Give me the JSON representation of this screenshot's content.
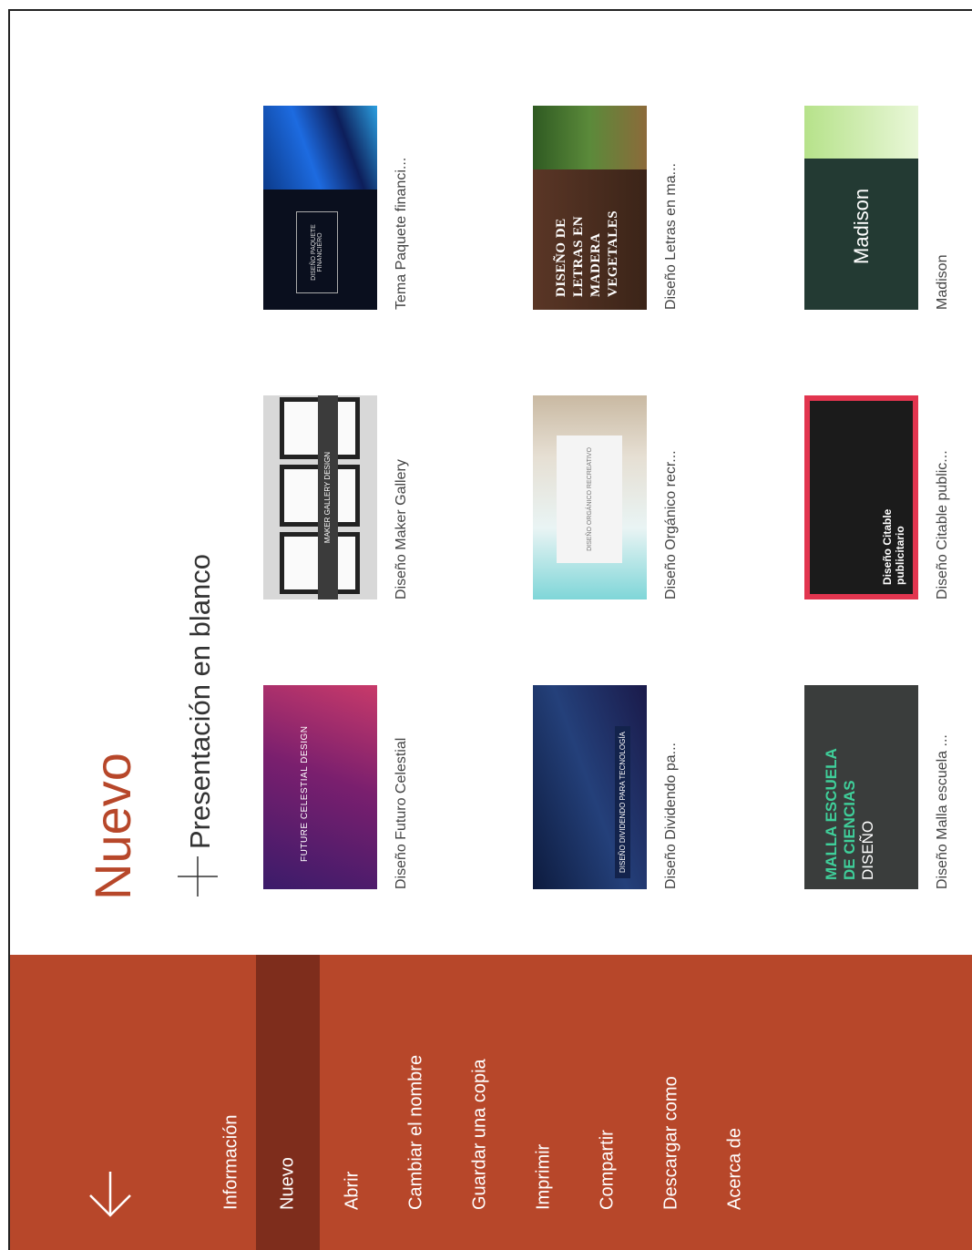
{
  "sidebar": {
    "back_icon": "arrow-left-icon",
    "items": [
      {
        "label": "Información"
      },
      {
        "label": "Nuevo",
        "active": true
      },
      {
        "label": "Abrir"
      },
      {
        "label": "Cambiar el nombre"
      },
      {
        "label": "Guardar una copia"
      },
      {
        "label": "Imprimir"
      },
      {
        "label": "Compartir"
      },
      {
        "label": "Descargar como"
      },
      {
        "label": "Acerca de"
      }
    ],
    "accent": "#b7472a",
    "active_bg": "#7e2d1c"
  },
  "main": {
    "title": "Nuevo",
    "blank_label": "Presentación en blanco",
    "templates": [
      {
        "caption": "Diseño Futuro Celestial",
        "thumb_text": "FUTURE CELESTIAL DESIGN"
      },
      {
        "caption": "Diseño Maker Gallery",
        "thumb_text": "MAKER GALLERY DESIGN"
      },
      {
        "caption": "Tema Paquete financi...",
        "thumb_text": "DISEÑO PAQUETE FINANCIERO"
      },
      {
        "caption": "Diseño Dividendo pa...",
        "thumb_text": "DISEÑO DIVIDENDO PARA TECNOLOGÍA"
      },
      {
        "caption": "Diseño Orgánico recr...",
        "thumb_text": "DISEÑO ORGÁNICO RECREATIVO"
      },
      {
        "caption": "Diseño Letras en ma...",
        "thumb_text": "DISEÑO DE LETRAS EN MADERA VEGETALES"
      },
      {
        "caption": "Diseño Malla escuela ...",
        "thumb_text_1": "MALLA ESCUELA DE CIENCIAS",
        "thumb_text_2": "DISEÑO"
      },
      {
        "caption": "Diseño Citable public...",
        "thumb_text": "Diseño Citable publicitario"
      },
      {
        "caption": "Madison",
        "thumb_text": "Madison"
      }
    ]
  }
}
